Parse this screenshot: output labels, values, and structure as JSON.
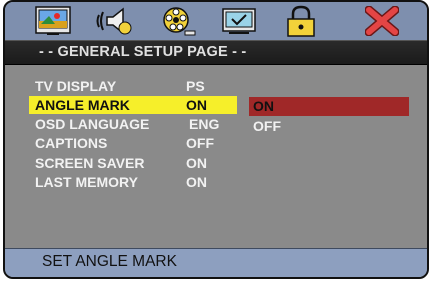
{
  "toolbar": {
    "icons": [
      "general-setup-icon",
      "audio-setup-icon",
      "video-setup-icon",
      "preference-icon",
      "password-icon",
      "exit-icon"
    ]
  },
  "title": "- - GENERAL SETUP PAGE - -",
  "menu": [
    {
      "label": "TV DISPLAY",
      "value": "PS"
    },
    {
      "label": "ANGLE MARK",
      "value": "ON",
      "selected": true
    },
    {
      "label": "OSD LANGUAGE",
      "value": "ENG"
    },
    {
      "label": "CAPTIONS",
      "value": "OFF"
    },
    {
      "label": "SCREEN SAVER",
      "value": "ON"
    },
    {
      "label": "LAST MEMORY",
      "value": "ON"
    }
  ],
  "options": [
    {
      "label": "ON",
      "selected": true
    },
    {
      "label": "OFF"
    }
  ],
  "help_text": "SET ANGLE MARK",
  "colors": {
    "toolbar": "#7e8fae",
    "title_bar": "#1b1b1b",
    "panel": "#8a8a8a",
    "highlight": "#f6ef2a",
    "option_highlight": "#a02828",
    "footer": "#8d9fbf"
  }
}
